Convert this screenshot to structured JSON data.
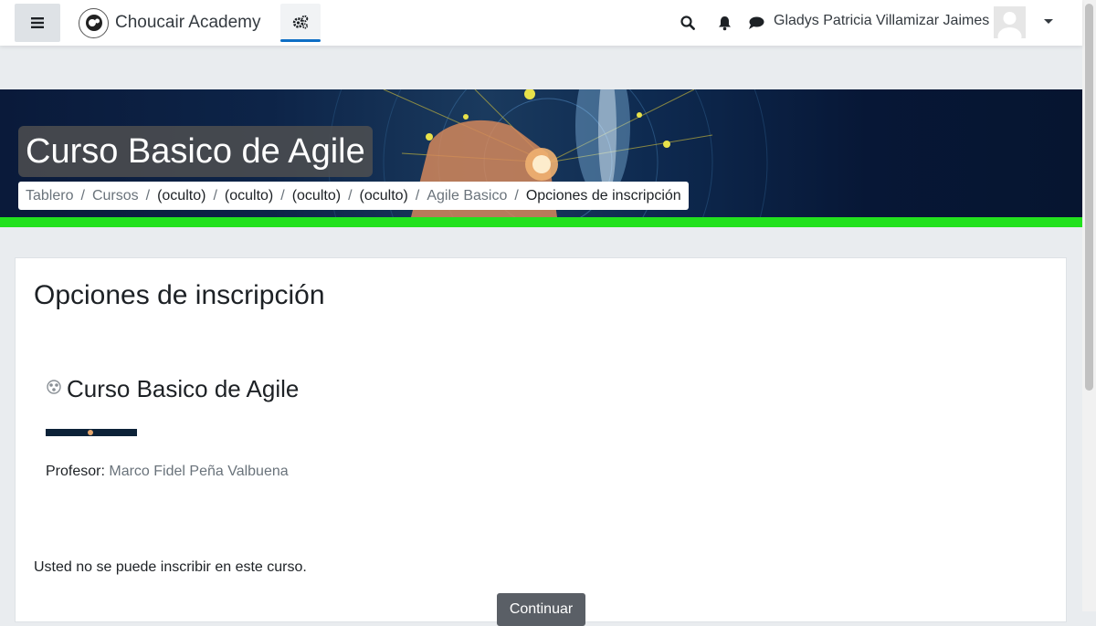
{
  "navbar": {
    "brand": "Choucair Academy",
    "user_name": "Gladys Patricia Villamizar Jaimes"
  },
  "icons": {
    "menu": "hamburger-menu-icon",
    "admin": "gears-icon",
    "search": "search-icon",
    "notifications": "bell-icon",
    "messages": "chat-bubble-icon",
    "user_menu": "caret-down-icon",
    "course": "course-icon"
  },
  "header": {
    "title": "Curso Basico de Agile",
    "breadcrumb": [
      {
        "label": "Tablero",
        "style": "link"
      },
      {
        "label": "Cursos",
        "style": "link"
      },
      {
        "label": "(oculto)",
        "style": "dark"
      },
      {
        "label": "(oculto)",
        "style": "dark"
      },
      {
        "label": "(oculto)",
        "style": "dark"
      },
      {
        "label": "(oculto)",
        "style": "dark"
      },
      {
        "label": "Agile Basico",
        "style": "link"
      },
      {
        "label": "Opciones de inscripción",
        "style": "dark"
      }
    ]
  },
  "main": {
    "heading": "Opciones de inscripción",
    "course": {
      "name": "Curso Basico de Agile",
      "teacher_label": "Profesor:",
      "teacher_name": "Marco Fidel Peña Valbuena"
    },
    "notice": "Usted no se puede inscribir en este curso.",
    "continue_label": "Continuar"
  },
  "colors": {
    "accent": "#0f6fc5",
    "banner_strip": "#22e11e",
    "button_bg": "#5a5f66"
  }
}
